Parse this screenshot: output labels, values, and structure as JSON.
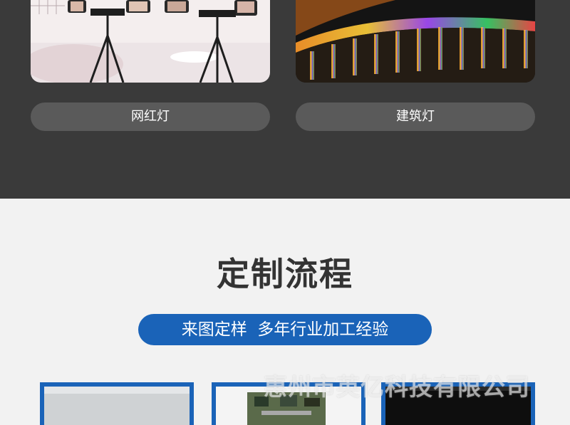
{
  "products": [
    {
      "label": "网红灯",
      "image_alt": "tripod ring lights photo"
    },
    {
      "label": "建筑灯",
      "image_alt": "colorful architectural lighting photo"
    }
  ],
  "process": {
    "title": "定制流程",
    "subtitle": "来图定样  多年行业加工经验",
    "watermark": "惠州市英亿科技有限公司"
  },
  "colors": {
    "dark_bg": "#3a3a3a",
    "pill_gray": "#5a5a5a",
    "light_bg": "#f2f2f2",
    "accent_blue": "#1a63b8",
    "title_color": "#333333"
  }
}
